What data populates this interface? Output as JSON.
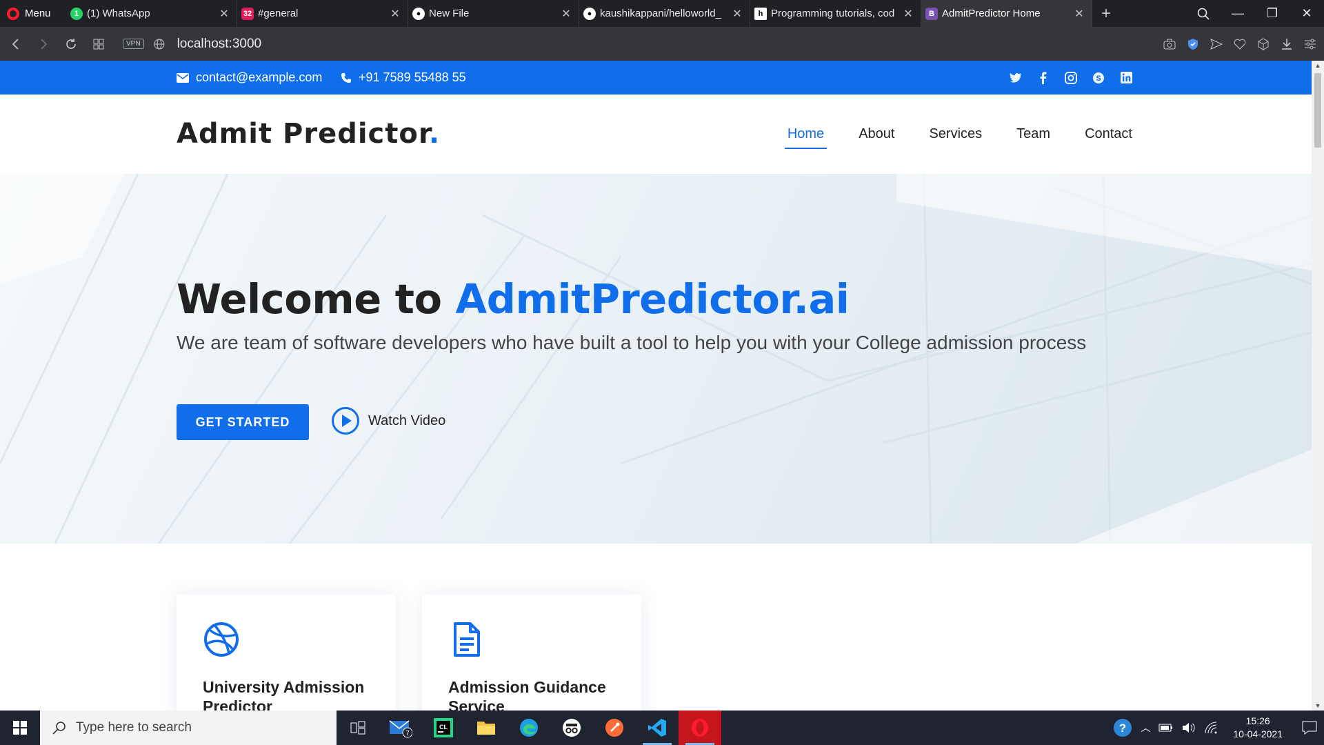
{
  "browser": {
    "menu_label": "Menu",
    "tabs": [
      {
        "title": "(1) WhatsApp",
        "badge": "1"
      },
      {
        "title": "#general",
        "badge": "32"
      },
      {
        "title": "New File"
      },
      {
        "title": "kaushikappani/helloworld_"
      },
      {
        "title": "Programming tutorials, cod"
      },
      {
        "title": "AdmitPredictor Home",
        "badge": "B"
      }
    ],
    "vpn_label": "VPN",
    "url": "localhost:3000"
  },
  "topbar": {
    "email": "contact@example.com",
    "phone": "+91 7589 55488 55",
    "socials": [
      "twitter-icon",
      "facebook-icon",
      "instagram-icon",
      "skype-icon",
      "linkedin-icon"
    ]
  },
  "header": {
    "logo_text": "Admit Predictor",
    "logo_dot": ".",
    "nav": [
      {
        "label": "Home",
        "active": true
      },
      {
        "label": "About"
      },
      {
        "label": "Services"
      },
      {
        "label": "Team"
      },
      {
        "label": "Contact"
      }
    ]
  },
  "hero": {
    "title_prefix": "Welcome to ",
    "title_accent": "AdmitPredictor.ai",
    "subtitle": "We are team of software developers who have built a tool to help you with your College admission process",
    "cta_label": "GET STARTED",
    "watch_label": "Watch Video"
  },
  "cards": [
    {
      "title": "University Admission Predictor",
      "icon": "dribbble-icon"
    },
    {
      "title": "Admission Guidance Service",
      "icon": "file-text-icon"
    }
  ],
  "taskbar": {
    "search_placeholder": "Type here to search",
    "mail_badge": "7",
    "time": "15:26",
    "date": "10-04-2021"
  },
  "colors": {
    "brand_blue": "#106eea",
    "dark_text": "#222222",
    "browser_dark": "#202124",
    "taskbar": "#1f2430"
  }
}
